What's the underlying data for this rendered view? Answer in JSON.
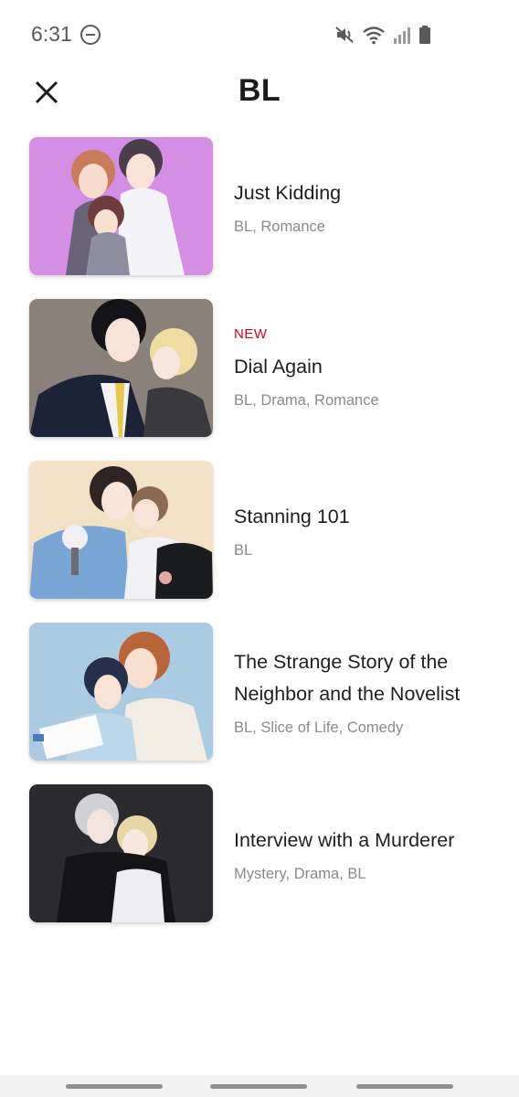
{
  "status_bar": {
    "time": "6:31",
    "icons": [
      "do-not-disturb-icon",
      "mute-icon",
      "wifi-icon",
      "signal-icon",
      "battery-icon"
    ]
  },
  "header": {
    "title": "BL",
    "close_icon": "close-icon"
  },
  "items": [
    {
      "title": "Just Kidding",
      "genres": "BL, Romance",
      "badge": "",
      "thumb_color": "#cf8fe0"
    },
    {
      "title": "Dial Again",
      "genres": "BL, Drama, Romance",
      "badge": "NEW",
      "thumb_color": "#8a807a"
    },
    {
      "title": "Stanning 101",
      "genres": "BL",
      "badge": "",
      "thumb_color": "#f1e0c2"
    },
    {
      "title": "The Strange Story of the Neighbor and the Novelist",
      "genres": "BL, Slice of Life, Comedy",
      "badge": "",
      "thumb_color": "#a9c9e0"
    },
    {
      "title": "Interview with a Murderer",
      "genres": "Mystery, Drama, BL",
      "badge": "",
      "thumb_color": "#2a2a2e"
    }
  ],
  "colors": {
    "badge": "#d0021b",
    "genres": "#8a8a8a"
  }
}
